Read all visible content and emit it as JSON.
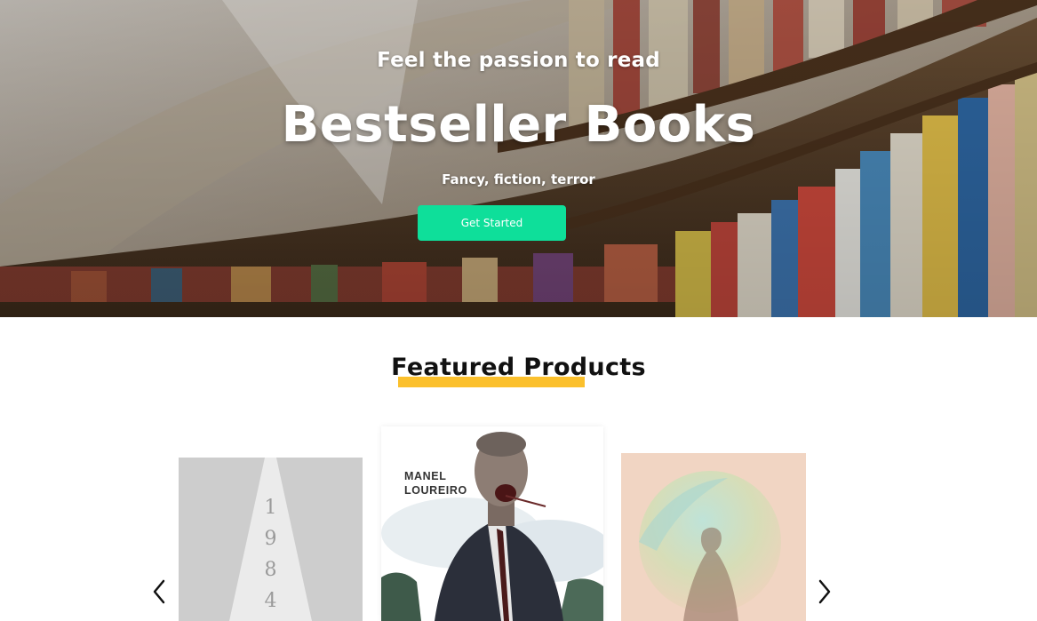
{
  "hero": {
    "tagline": "Feel the passion to read",
    "title": "Bestseller Books",
    "subtitle": "Fancy, fiction, terror",
    "cta_label": "Get Started"
  },
  "featured": {
    "title": "Featured Products",
    "books": [
      {
        "cover_digits": [
          "1",
          "9",
          "8",
          "4"
        ]
      },
      {
        "author_line1": "MANEL",
        "author_line2": "LOUREIRO"
      },
      {}
    ]
  },
  "colors": {
    "accent": "#0edf9a",
    "underline": "#fbc02d"
  },
  "icons": {
    "prev": "chevron-left-icon",
    "next": "chevron-right-icon"
  }
}
